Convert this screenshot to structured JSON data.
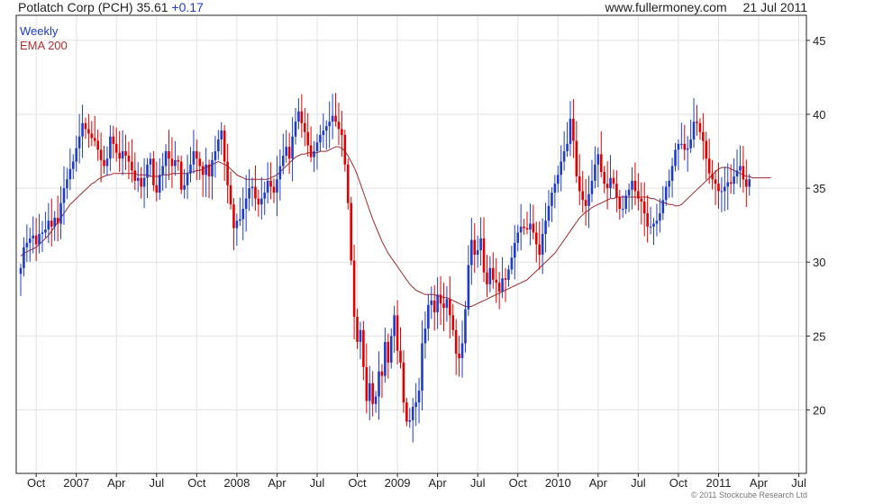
{
  "header": {
    "ticker_text": "Potlatch Corp (PCH)",
    "price": "35.61",
    "change": "+0.17",
    "site": "www.fullermoney.com",
    "date": "21 Jul 2011"
  },
  "legend": {
    "weekly": "Weekly",
    "ema": "EMA 200"
  },
  "copyright": "© 2011 Stockcube Research Ltd",
  "colors": {
    "up": "#1e3cc8",
    "down": "#e00000",
    "ema": "#9a2a2a",
    "grid": "#e2e2e2"
  },
  "chart_data": {
    "type": "candlestick",
    "title": "Potlatch Corp (PCH)",
    "interval": "Weekly",
    "y_ticks": [
      20,
      25,
      30,
      35,
      40,
      45
    ],
    "ylim": [
      15.7,
      46.7
    ],
    "x_ticks": [
      "Oct",
      "2007",
      "Apr",
      "Jul",
      "Oct",
      "2008",
      "Apr",
      "Jul",
      "Oct",
      "2009",
      "Apr",
      "Jul",
      "Oct",
      "2010",
      "Apr",
      "Jul",
      "Oct",
      "2011",
      "Apr",
      "Jul"
    ],
    "x_tick_weeks": [
      5,
      18,
      31,
      44,
      57,
      70,
      83,
      96,
      109,
      122,
      135,
      148,
      161,
      174,
      187,
      200,
      213,
      226,
      239,
      252
    ],
    "n_weeks": 252,
    "closes": [
      29.6,
      31.0,
      31.3,
      31.6,
      31.8,
      31.2,
      31.9,
      32.0,
      32.2,
      32.8,
      32.4,
      33.0,
      32.6,
      34.0,
      35.0,
      35.6,
      36.3,
      36.8,
      37.7,
      38.5,
      39.4,
      39.0,
      38.7,
      38.4,
      38.2,
      37.6,
      36.9,
      36.5,
      37.0,
      38.5,
      38.0,
      37.4,
      37.0,
      37.5,
      37.2,
      36.8,
      36.2,
      35.5,
      35.7,
      35.1,
      35.7,
      36.6,
      37.0,
      35.2,
      34.7,
      35.9,
      36.5,
      37.5,
      37.0,
      36.5,
      36.9,
      36.8,
      34.9,
      35.2,
      36.0,
      36.6,
      37.5,
      37.0,
      36.5,
      35.9,
      36.6,
      35.8,
      36.9,
      37.5,
      38.3,
      38.9,
      36.8,
      35.2,
      33.9,
      32.3,
      32.8,
      32.9,
      33.6,
      34.3,
      35.0,
      35.1,
      34.3,
      33.9,
      34.3,
      34.7,
      35.5,
      35.1,
      34.7,
      35.6,
      36.5,
      37.2,
      37.8,
      37.0,
      38.5,
      39.5,
      40.2,
      39.4,
      38.8,
      37.9,
      37.1,
      37.5,
      38.1,
      38.6,
      38.9,
      39.2,
      39.5,
      39.9,
      39.5,
      39.0,
      38.6,
      36.6,
      34.0,
      30.1,
      26.3,
      24.6,
      25.4,
      22.9,
      20.6,
      21.8,
      20.4,
      20.9,
      22.6,
      22.3,
      24.6,
      23.2,
      25.0,
      26.4,
      24.0,
      23.2,
      20.5,
      19.2,
      19.3,
      20.2,
      20.5,
      21.3,
      24.5,
      25.5,
      27.1,
      27.4,
      26.6,
      27.8,
      27.2,
      26.9,
      27.5,
      26.4,
      25.4,
      23.8,
      23.5,
      24.5,
      26.8,
      29.8,
      31.5,
      30.5,
      30.8,
      31.6,
      29.3,
      28.5,
      29.6,
      28.8,
      28.6,
      28.0,
      28.9,
      28.8,
      29.5,
      30.3,
      31.3,
      32.0,
      32.4,
      32.3,
      32.2,
      32.6,
      32.0,
      31.2,
      30.5,
      31.9,
      32.8,
      33.8,
      34.7,
      35.3,
      35.9,
      36.8,
      37.5,
      38.0,
      39.7,
      38.2,
      35.8,
      34.8,
      34.2,
      33.8,
      34.6,
      35.5,
      36.6,
      37.3,
      36.1,
      35.3,
      35.0,
      35.7,
      35.3,
      34.4,
      33.6,
      33.6,
      34.5,
      34.9,
      35.5,
      34.8,
      34.3,
      34.1,
      33.3,
      32.4,
      32.4,
      32.6,
      32.8,
      33.3,
      34.2,
      35.1,
      35.5,
      36.5,
      37.6,
      38.0,
      38.0,
      37.6,
      37.7,
      38.3,
      39.5,
      39.4,
      38.8,
      38.2,
      37.0,
      36.0,
      35.6,
      35.3,
      34.8,
      34.8,
      35.1,
      35.4,
      35.3,
      35.8,
      36.2,
      36.5,
      35.6,
      35.1,
      35.6
    ],
    "ema_200": [
      30.4,
      30.6,
      30.7,
      30.8,
      30.9,
      31.0,
      31.2,
      31.4,
      31.6,
      31.8,
      32.1,
      32.4,
      32.7,
      33.0,
      33.3,
      33.6,
      33.9,
      34.1,
      34.3,
      34.5,
      34.7,
      34.9,
      35.1,
      35.3,
      35.4,
      35.6,
      35.7,
      35.8,
      35.9,
      35.9,
      36.0,
      36.0,
      36.0,
      36.0,
      36.0,
      36.0,
      36.0,
      36.0,
      35.9,
      35.9,
      35.9,
      35.9,
      35.8,
      35.8,
      35.8,
      35.8,
      35.9,
      35.9,
      35.9,
      36.0,
      36.0,
      36.0,
      36.0,
      36.0,
      36.0,
      36.1,
      36.1,
      36.2,
      36.2,
      36.3,
      36.4,
      36.5,
      36.6,
      36.7,
      36.8,
      36.7,
      36.6,
      36.5,
      36.3,
      36.1,
      35.9,
      35.8,
      35.7,
      35.6,
      35.6,
      35.6,
      35.6,
      35.6,
      35.6,
      35.6,
      35.6,
      35.7,
      35.8,
      35.9,
      36.1,
      36.3,
      36.5,
      36.7,
      36.9,
      37.1,
      37.2,
      37.3,
      37.3,
      37.4,
      37.4,
      37.4,
      37.4,
      37.5,
      37.5,
      37.5,
      37.6,
      37.7,
      37.8,
      37.8,
      37.7,
      37.5,
      37.2,
      36.8,
      36.4,
      35.9,
      35.3,
      34.7,
      34.1,
      33.5,
      32.9,
      32.4,
      31.9,
      31.4,
      31.0,
      30.6,
      30.3,
      30.0,
      29.7,
      29.4,
      29.1,
      28.8,
      28.5,
      28.3,
      28.1,
      28.0,
      27.9,
      27.8,
      27.8,
      27.8,
      27.8,
      27.7,
      27.7,
      27.6,
      27.6,
      27.5,
      27.4,
      27.3,
      27.2,
      27.1,
      27.0,
      27.0,
      27.0,
      27.1,
      27.2,
      27.3,
      27.4,
      27.5,
      27.6,
      27.7,
      27.8,
      27.9,
      28.0,
      28.1,
      28.2,
      28.3,
      28.4,
      28.5,
      28.6,
      28.7,
      28.8,
      29.0,
      29.2,
      29.4,
      29.6,
      29.8,
      30.0,
      30.2,
      30.4,
      30.6,
      30.9,
      31.2,
      31.5,
      31.8,
      32.1,
      32.4,
      32.7,
      33.0,
      33.2,
      33.4,
      33.5,
      33.7,
      33.8,
      33.9,
      34.0,
      34.1,
      34.2,
      34.3,
      34.3,
      34.4,
      34.4,
      34.4,
      34.4,
      34.4,
      34.4,
      34.4,
      34.4,
      34.4,
      34.4,
      34.4,
      34.3,
      34.3,
      34.2,
      34.1,
      34.0,
      34.0,
      33.9,
      33.9,
      33.8,
      33.8,
      33.9,
      34.1,
      34.3,
      34.5,
      34.7,
      34.9,
      35.1,
      35.3,
      35.5,
      35.7,
      35.9,
      36.1,
      36.3,
      36.4,
      36.4,
      36.4,
      36.3,
      36.2,
      36.1,
      36.0,
      35.9,
      35.8,
      35.8,
      35.7,
      35.7,
      35.7,
      35.7,
      35.7,
      35.7,
      35.7
    ],
    "grid": true,
    "legend_position": "top-left"
  }
}
